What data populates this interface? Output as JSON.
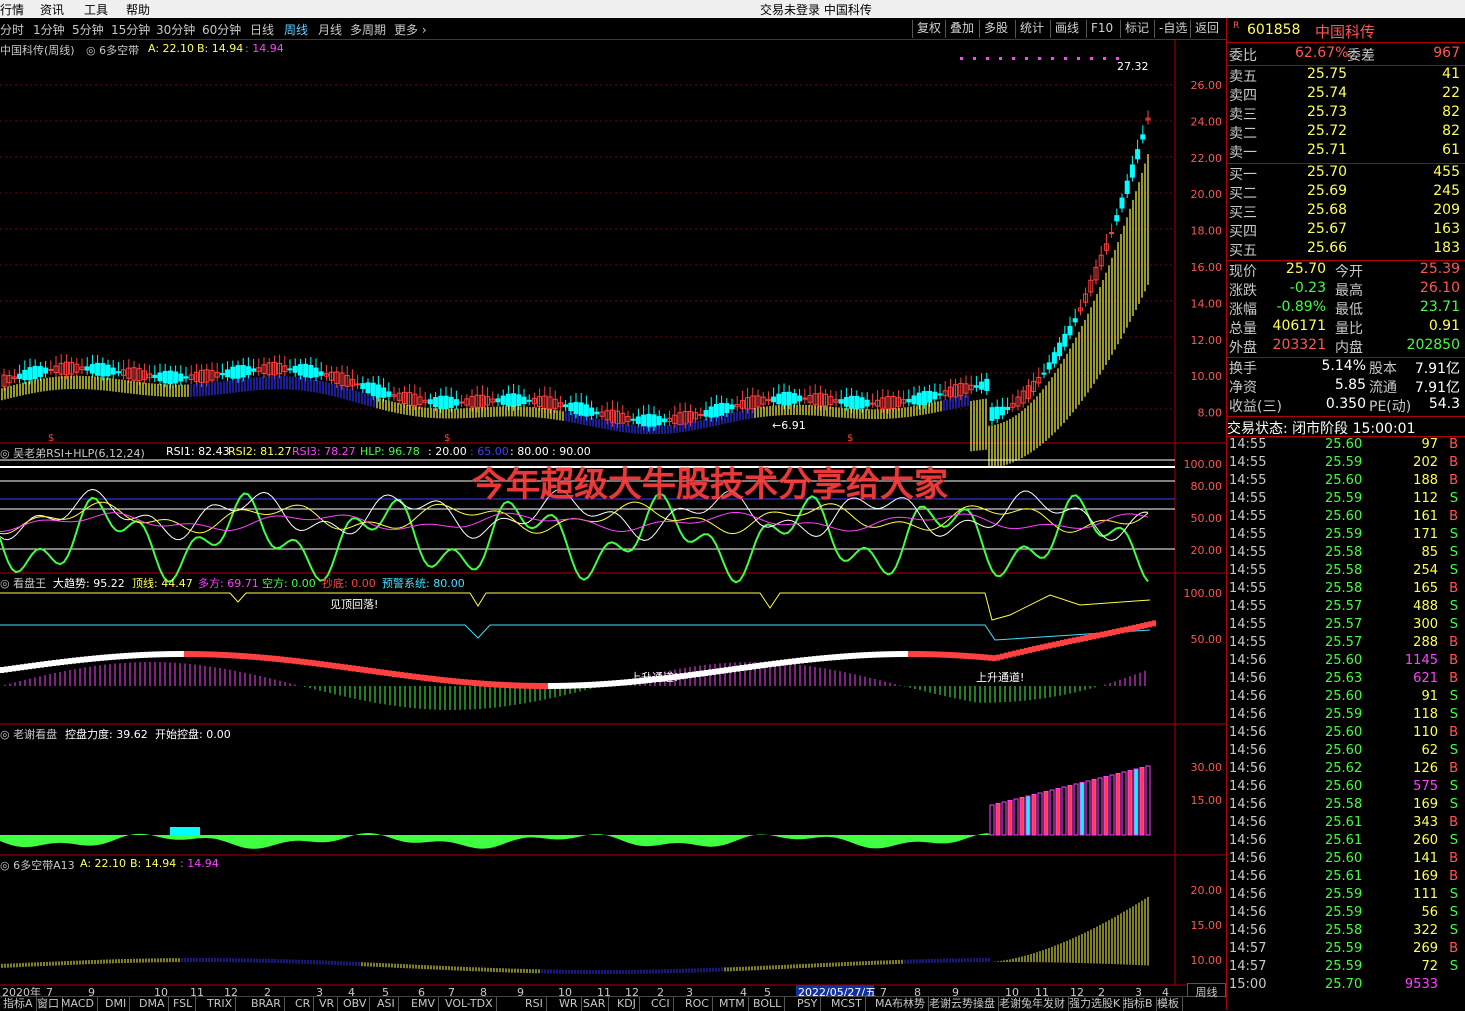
{
  "window": {
    "title": "交易未登录  中国科传"
  },
  "menu": [
    "行情",
    "资讯",
    "工具",
    "帮助"
  ],
  "periods": [
    "分时",
    "1分钟",
    "5分钟",
    "15分钟",
    "30分钟",
    "60分钟",
    "日线",
    "周线",
    "月线",
    "多周期",
    "更多"
  ],
  "active_period": "周线",
  "toolbar": [
    "复权",
    "叠加",
    "多股",
    "统计",
    "画线",
    "F10",
    "标记",
    "-自选",
    "返回"
  ],
  "panel1": {
    "name": "中国科传(周线)",
    "ind": "6多空带",
    "a": "A: 22.10",
    "b": "B: 14.94",
    "c": ": 14.94",
    "price_ticks": [
      "26.00",
      "24.00",
      "22.00",
      "20.00",
      "18.00",
      "16.00",
      "14.00",
      "12.00",
      "10.00",
      "8.00"
    ],
    "hi_label": "27.32",
    "lo_label": "6.91"
  },
  "panel2": {
    "name": "吴老弟RSI+HLP(6,12,24)",
    "rsi1": "RSI1: 82.43",
    "rsi2": "RSI2: 81.27",
    "rsi3": "RSI3: 78.27",
    "hlp": "HLP: 96.78",
    "l1": ": 20.00",
    "l2": ": 65.00",
    "l3": ": 80.00",
    "l4": ": 90.00",
    "ticks": [
      "100.00",
      "80.00",
      "50.00",
      "20.00"
    ]
  },
  "panel3": {
    "name": "看盘王",
    "t1": "大趋势: 95.22",
    "t2": "顶线: 44.47",
    "t3": "多方: 69.71",
    "t4": "空方: 0.00",
    "t5": "抄底: 0.00",
    "t6": "预警系统: 80.00",
    "note1": "见顶回落!",
    "note2": "上升通道!",
    "note3": "上升通道!",
    "ticks": [
      "100.00",
      "50.00"
    ]
  },
  "panel4": {
    "name": "老谢看盘",
    "t1": "控盘力度: 39.62",
    "t2": "开始控盘: 0.00",
    "ticks": [
      "30.00",
      "15.00"
    ]
  },
  "panel5": {
    "name": "6多空带A13",
    "a": "A: 22.10",
    "b": "B: 14.94",
    "c": ": 14.94",
    "ticks": [
      "20.00",
      "15.00",
      "10.00"
    ]
  },
  "xaxis": {
    "labels": [
      "2020年",
      "7",
      "9",
      "10",
      "11",
      "12",
      "2",
      "3",
      "4",
      "5",
      "6",
      "7",
      "8",
      "9",
      "10",
      "11",
      "12",
      "2",
      "3",
      "4",
      "5",
      "6",
      "7",
      "8",
      "9",
      "10",
      "11",
      "12",
      "2",
      "3",
      "4"
    ],
    "cursor_date": "2022/05/27/五"
  },
  "overlay_text": "今年超级大牛股技术分享给大家",
  "tabs": [
    "指标A",
    "窗口",
    "MACD",
    "DMI",
    "DMA",
    "FSL",
    "TRIX",
    "BRAR",
    "CR",
    "VR",
    "OBV",
    "ASI",
    "EMV",
    "VOL-TDX",
    "RSI",
    "WR",
    "SAR",
    "KDJ",
    "CCI",
    "ROC",
    "MTM",
    "BOLL",
    "PSY",
    "MCST",
    "MA布林势",
    "老谢云势操盘",
    "老谢兔年发财",
    "强力选股K",
    "指标B",
    "模板"
  ],
  "period_box": "周线",
  "quote": {
    "code": "601858",
    "name": "中国科传",
    "r": "R",
    "weibi": [
      "委比",
      "62.67%",
      "委差",
      "967"
    ],
    "asks": [
      [
        "卖五",
        "25.75",
        "41"
      ],
      [
        "卖四",
        "25.74",
        "22"
      ],
      [
        "卖三",
        "25.73",
        "82"
      ],
      [
        "卖二",
        "25.72",
        "82"
      ],
      [
        "卖一",
        "25.71",
        "61"
      ]
    ],
    "bids": [
      [
        "买一",
        "25.70",
        "455"
      ],
      [
        "买二",
        "25.69",
        "245"
      ],
      [
        "买三",
        "25.68",
        "209"
      ],
      [
        "买四",
        "25.67",
        "163"
      ],
      [
        "买五",
        "25.66",
        "183"
      ]
    ],
    "stats": [
      [
        "现价",
        "25.70",
        "今开",
        "25.39"
      ],
      [
        "涨跌",
        "-0.23",
        "最高",
        "26.10"
      ],
      [
        "涨幅",
        "-0.89%",
        "最低",
        "23.71"
      ],
      [
        "总量",
        "406171",
        "量比",
        "0.91"
      ],
      [
        "外盘",
        "203321",
        "内盘",
        "202850"
      ]
    ],
    "stats2": [
      [
        "换手",
        "5.14%",
        "股本",
        "7.91亿"
      ],
      [
        "净资",
        "5.85",
        "流通",
        "7.91亿"
      ],
      [
        "收益(三)",
        "0.350",
        "PE(动)",
        "54.3"
      ]
    ],
    "status": "交易状态: 闭市阶段 15:00:01"
  },
  "trades": [
    [
      "14:55",
      "25.60",
      "97",
      "B"
    ],
    [
      "14:55",
      "25.59",
      "202",
      "B"
    ],
    [
      "14:55",
      "25.60",
      "188",
      "B"
    ],
    [
      "14:55",
      "25.59",
      "112",
      "S"
    ],
    [
      "14:55",
      "25.60",
      "161",
      "B"
    ],
    [
      "14:55",
      "25.59",
      "171",
      "S"
    ],
    [
      "14:55",
      "25.58",
      "85",
      "S"
    ],
    [
      "14:55",
      "25.58",
      "254",
      "S"
    ],
    [
      "14:55",
      "25.58",
      "165",
      "B"
    ],
    [
      "14:55",
      "25.57",
      "488",
      "S"
    ],
    [
      "14:55",
      "25.57",
      "300",
      "S"
    ],
    [
      "14:55",
      "25.57",
      "288",
      "B"
    ],
    [
      "14:56",
      "25.60",
      "1145",
      "B"
    ],
    [
      "14:56",
      "25.63",
      "621",
      "B"
    ],
    [
      "14:56",
      "25.60",
      "91",
      "S"
    ],
    [
      "14:56",
      "25.59",
      "118",
      "S"
    ],
    [
      "14:56",
      "25.60",
      "110",
      "B"
    ],
    [
      "14:56",
      "25.60",
      "62",
      "S"
    ],
    [
      "14:56",
      "25.62",
      "126",
      "B"
    ],
    [
      "14:56",
      "25.60",
      "575",
      "S"
    ],
    [
      "14:56",
      "25.58",
      "169",
      "S"
    ],
    [
      "14:56",
      "25.61",
      "343",
      "B"
    ],
    [
      "14:56",
      "25.61",
      "260",
      "S"
    ],
    [
      "14:56",
      "25.60",
      "141",
      "B"
    ],
    [
      "14:56",
      "25.61",
      "169",
      "B"
    ],
    [
      "14:56",
      "25.59",
      "111",
      "S"
    ],
    [
      "14:56",
      "25.59",
      "56",
      "S"
    ],
    [
      "14:56",
      "25.58",
      "322",
      "S"
    ],
    [
      "14:57",
      "25.59",
      "269",
      "B"
    ],
    [
      "14:57",
      "25.59",
      "72",
      "S"
    ],
    [
      "15:00",
      "25.70",
      "9533",
      ""
    ]
  ],
  "colors": {
    "up": "#ff4040",
    "down": "#00ffff",
    "yellow": "#ffff40",
    "blue": "#3030ff",
    "green": "#40ff40",
    "magenta": "#ff40ff",
    "grid": "#7a0000"
  }
}
